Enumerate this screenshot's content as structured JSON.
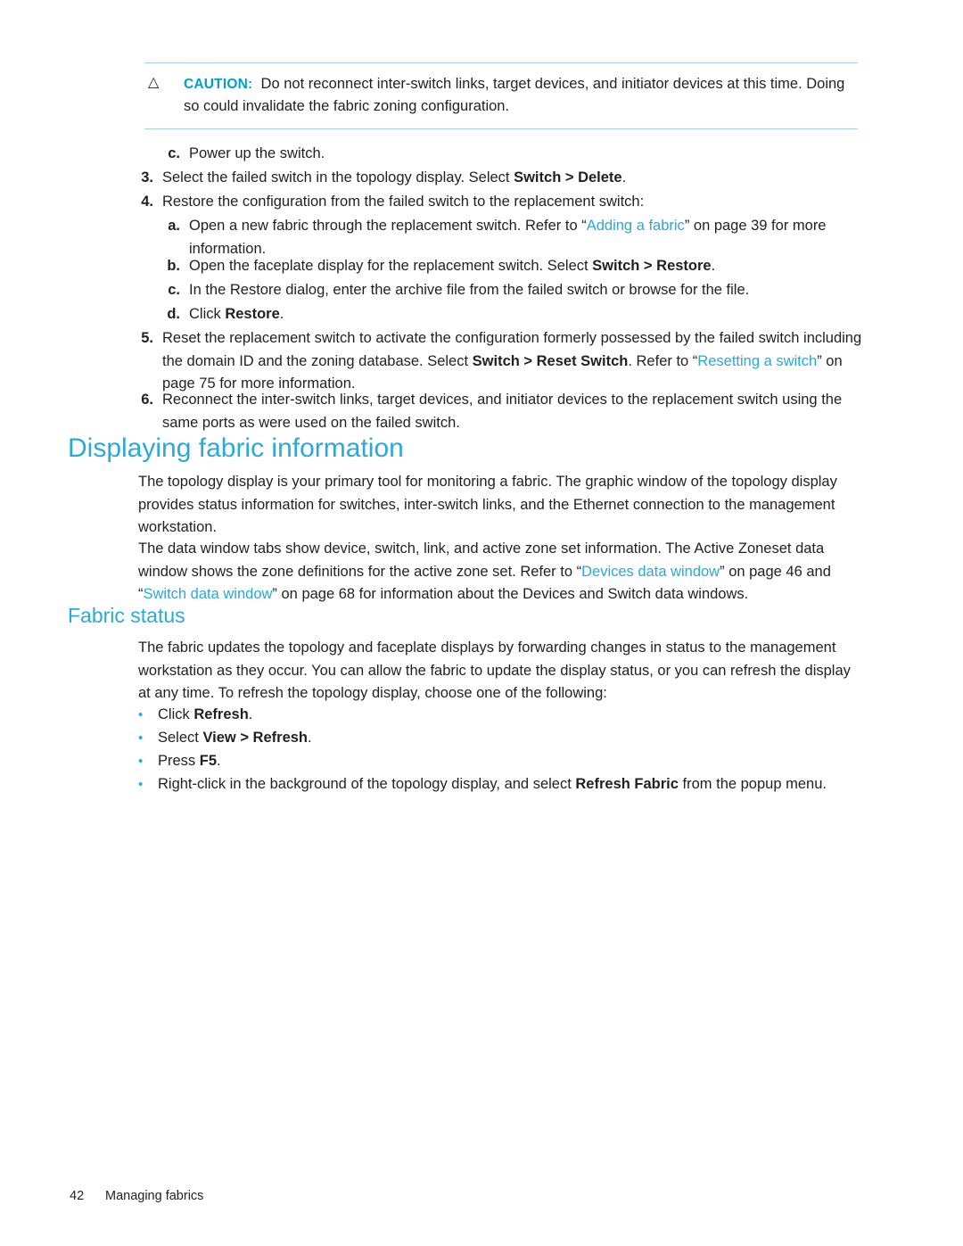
{
  "caution": {
    "icon": "warning-triangle-icon",
    "label": "CAUTION:",
    "text": "Do not reconnect inter-switch links, target devices, and initiator devices at this time. Doing so could invalidate the fabric zoning configuration."
  },
  "steps": {
    "step_c_power": {
      "marker": "c.",
      "text": "Power up the switch."
    },
    "step_3": {
      "marker": "3.",
      "pre": "Select the failed switch in the topology display. Select ",
      "bold": "Switch > Delete",
      "post": "."
    },
    "step_4": {
      "marker": "4.",
      "text": "Restore the configuration from the failed switch to the replacement switch:"
    },
    "step_4a": {
      "marker": "a.",
      "pre": "Open a new fabric through the replacement switch. Refer to “",
      "link": "Adding a fabric",
      "post": "” on page 39 for more information."
    },
    "step_4b": {
      "marker": "b.",
      "pre": "Open the faceplate display for the replacement switch. Select ",
      "bold": "Switch > Restore",
      "post": "."
    },
    "step_4c": {
      "marker": "c.",
      "text": "In the Restore dialog, enter the archive file from the failed switch or browse for the file."
    },
    "step_4d": {
      "marker": "d.",
      "pre": "Click ",
      "bold": "Restore",
      "post": "."
    },
    "step_5": {
      "marker": "5.",
      "pre": "Reset the replacement switch to activate the configuration formerly possessed by the failed switch including the domain ID and the zoning database. Select ",
      "bold": "Switch > Reset Switch",
      "mid": ". Refer to “",
      "link": "Resetting a switch",
      "post": "” on page 75 for more information."
    },
    "step_6": {
      "marker": "6.",
      "text": "Reconnect the inter-switch links, target devices, and initiator devices to the replacement switch using the same ports as were used on the failed switch."
    }
  },
  "headings": {
    "displaying_fabric_information": "Displaying fabric information",
    "fabric_status": "Fabric status"
  },
  "body": {
    "p1": "The topology display is your primary tool for monitoring a fabric. The graphic window of the topology display provides status information for switches, inter-switch links, and the Ethernet connection to the management workstation.",
    "p2_pre": "The data window tabs show device, switch, link, and active zone set information. The Active Zoneset data window shows the zone definitions for the active zone set. Refer to “",
    "p2_link1": "Devices data window",
    "p2_mid": "” on page 46 and “",
    "p2_link2": "Switch data window",
    "p2_post": "” on page 68 for information about the Devices and Switch data windows.",
    "p3": "The fabric updates the topology and faceplate displays by forwarding changes in status to the management workstation as they occur. You can allow the fabric to update the display status, or you can refresh the display at any time. To refresh the topology display, choose one of the following:"
  },
  "bullets": {
    "b1_pre": "Click ",
    "b1_bold": "Refresh",
    "b1_post": ".",
    "b2_pre": "Select ",
    "b2_bold": "View > Refresh",
    "b2_post": ".",
    "b3_pre": "Press ",
    "b3_bold": "F5",
    "b3_post": ".",
    "b4_pre": "Right-click in the background of the topology display, and select ",
    "b4_bold": "Refresh Fabric",
    "b4_post": " from the popup menu."
  },
  "footer": {
    "page_number": "42",
    "chapter": "Managing fabrics"
  }
}
